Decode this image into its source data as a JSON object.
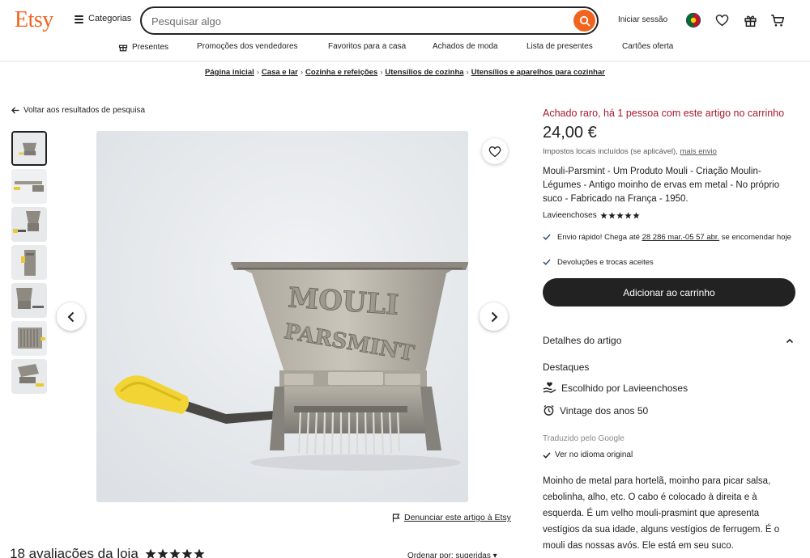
{
  "header": {
    "logo": "Etsy",
    "categories_label": "Categorias",
    "search_placeholder": "Pesquisar algo",
    "sign_in": "Iniciar sessão"
  },
  "subnav": [
    "Presentes",
    "Promoções dos vendedores",
    "Favoritos para a casa",
    "Achados de moda",
    "Lista de presentes",
    "Cartões oferta"
  ],
  "breadcrumb": [
    "Página inicial",
    "Casa e lar",
    "Cozinha e refeições",
    "Utensílios de cozinha",
    "Utensílios e aparelhos para cozinhar"
  ],
  "back_link": "Voltar aos resultados de pesquisa",
  "report_link": "Denunciar este artigo à Etsy",
  "reviews": {
    "heading": "18 avaliações da loja",
    "rating": 5,
    "sort": "Ordenar por: sugeridas"
  },
  "product": {
    "image_text": {
      "line1": "MOULI",
      "line2": "PARSMINT"
    },
    "rare_notice": "Achado raro, há 1 pessoa com este artigo no carrinho",
    "price": "24,00 €",
    "tax_note": "Impostos locais incluídos (se aplicável), ",
    "tax_link": "mais envio",
    "title": "Mouli-Parsmint - Um Produto Mouli - Criação Moulin-Légumes - Antigo moinho de ervas em metal - No próprio suco - Fabricado na França - 1950.",
    "seller": "Lavieenchoses",
    "seller_rating": 5,
    "shipping_prefix": "Envio rápido! Chega até ",
    "shipping_dates": "28 286 mar.-05 57 abr.",
    "shipping_suffix": " se encomendar hoje",
    "returns": "Devoluções e trocas aceites",
    "add_to_cart": "Adicionar ao carrinho",
    "details_heading": "Detalhes do artigo",
    "highlights_heading": "Destaques",
    "highlight_1": "Escolhido por Lavieenchoses",
    "highlight_2": "Vintage dos anos 50",
    "translated_note": "Traduzido pelo Google",
    "original_link": "Ver no idioma original",
    "description": "Moinho de metal para hortelã, moinho para picar salsa, cebolinha, alho, etc. O cabo é colocado à direita e à esquerda. É um velho mouli-prasmint que apresenta vestígios da sua idade, alguns vestígios de ferrugem. É o mouli das nossas avós. Ele está em seu suco."
  },
  "colors": {
    "brand": "#f1641e",
    "rare": "#a61a2e",
    "button": "#222222"
  }
}
